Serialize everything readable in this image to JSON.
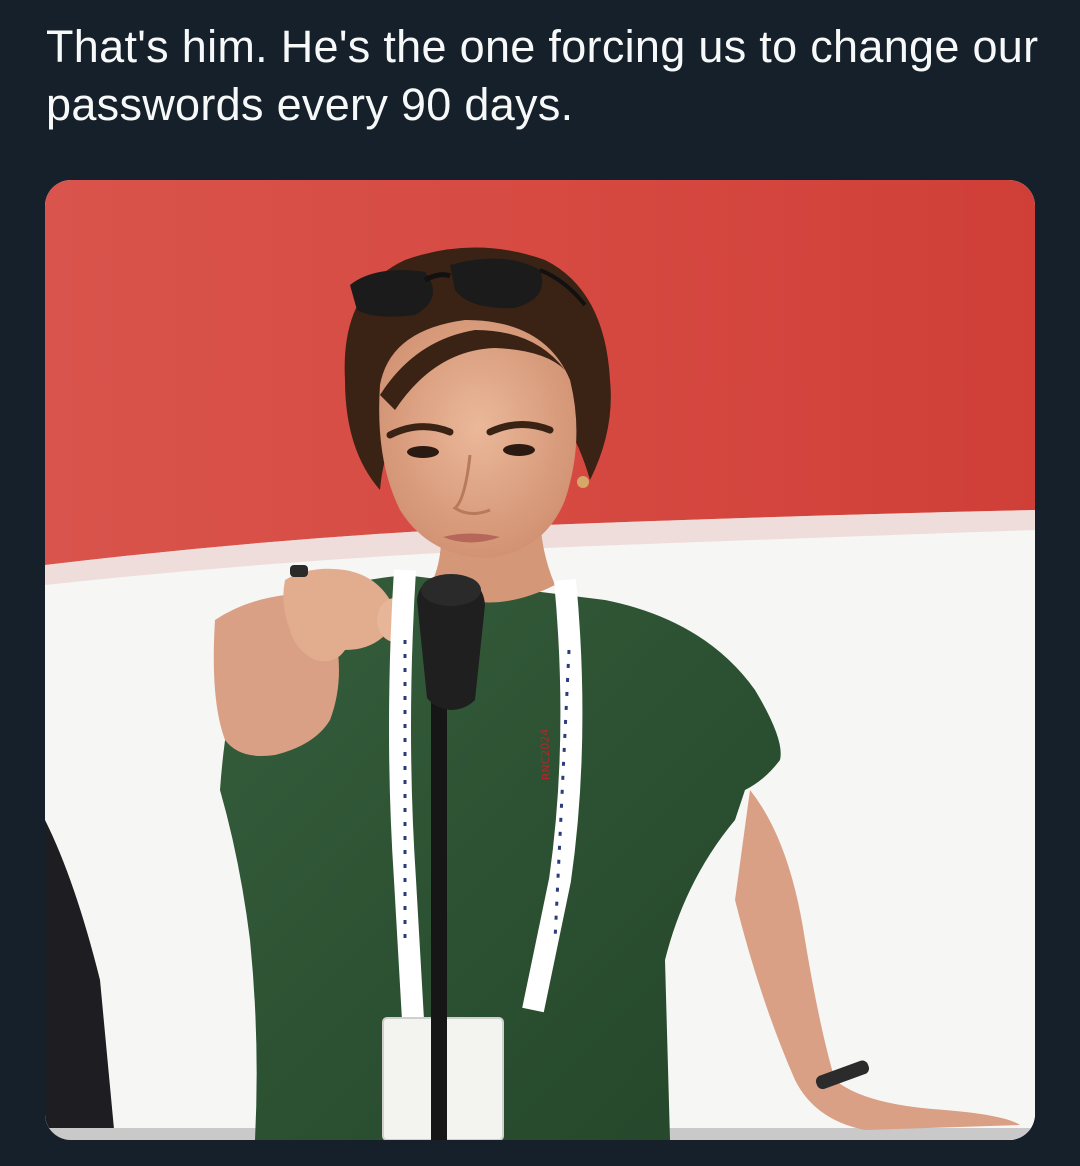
{
  "tweet": {
    "text": "That's him. He's the one forcing us to change our passwords every 90 days."
  },
  "media": {
    "lanyard_text": "RNC2024",
    "colors": {
      "background": "#15202b",
      "text": "#f7f9f9",
      "backdrop_red": "#d84a43",
      "backdrop_white": "#f7f7f7",
      "shirt": "#2d5133",
      "skin": "#e2a98a",
      "hair": "#3b2416"
    }
  }
}
